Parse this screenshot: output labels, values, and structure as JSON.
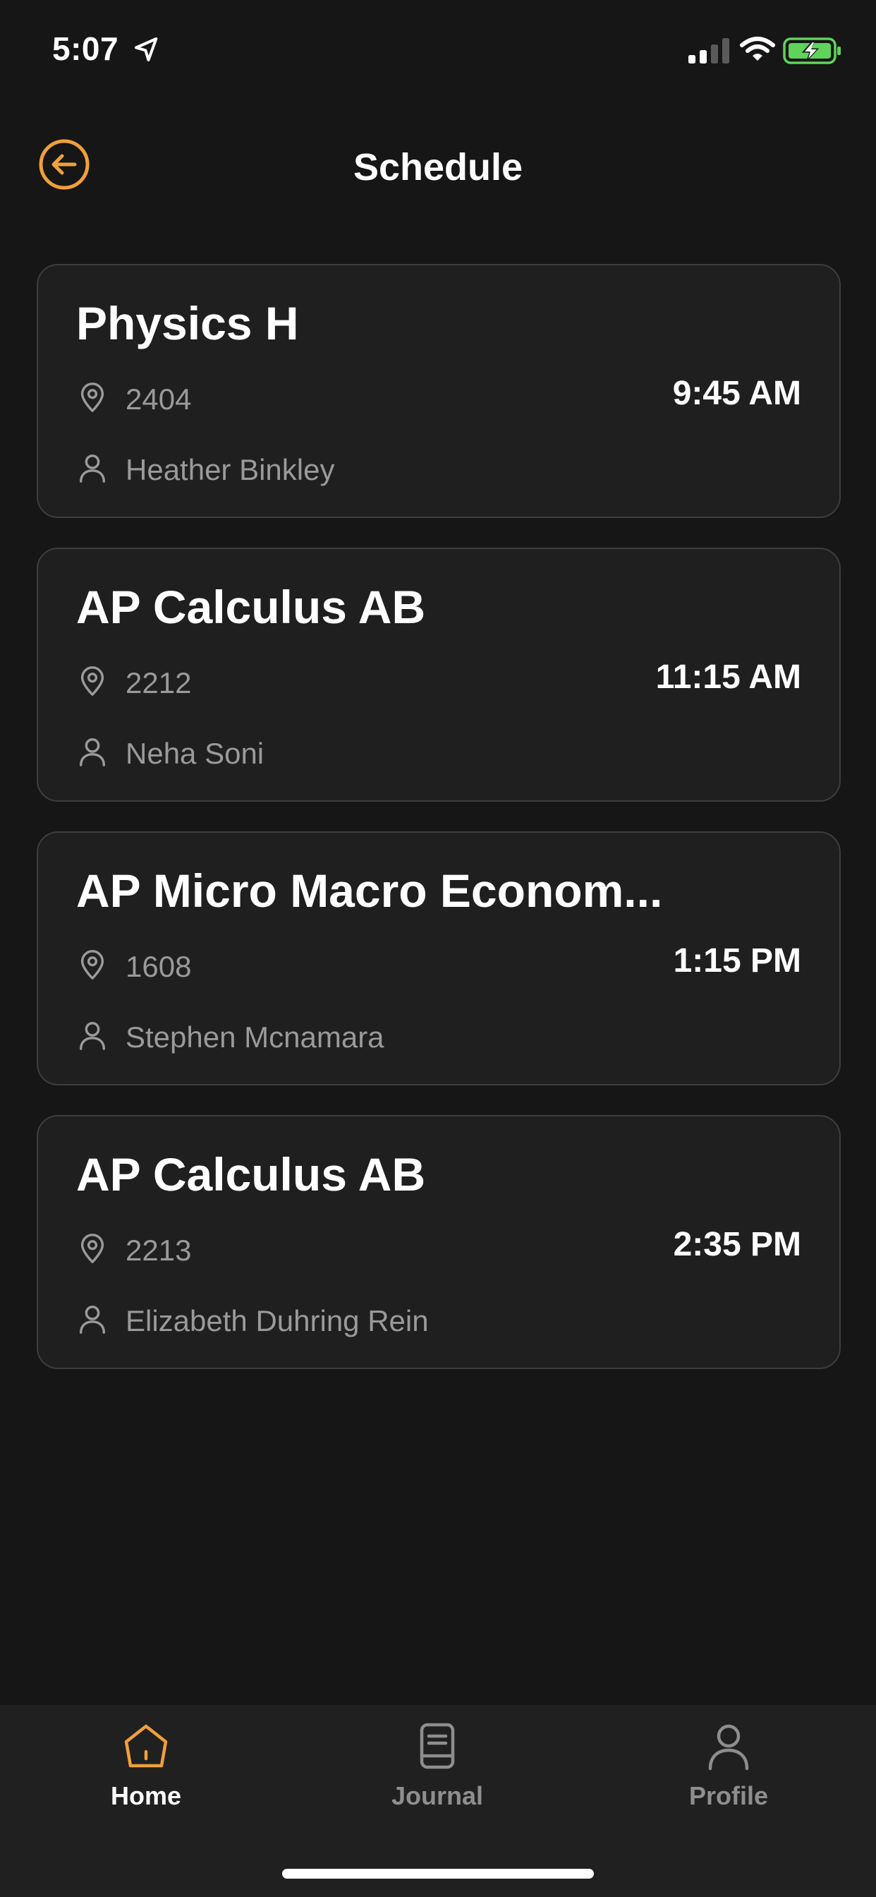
{
  "status_bar": {
    "time": "5:07",
    "icons": [
      "location-arrow-icon",
      "cellular-signal-icon",
      "wifi-icon",
      "battery-charging-icon"
    ]
  },
  "header": {
    "title": "Schedule",
    "back_icon": "back-arrow-icon"
  },
  "colors": {
    "accent": "#F0A03A",
    "background": "#161616",
    "card": "#1F1F1F",
    "card_border": "#3D3D3D",
    "secondary_text": "#9A9A9A",
    "battery_green": "#5FD35A"
  },
  "classes": [
    {
      "name": "Physics H",
      "room": "2404",
      "teacher": "Heather Binkley",
      "time": "9:45 AM"
    },
    {
      "name": "AP Calculus AB",
      "room": "2212",
      "teacher": "Neha Soni",
      "time": "11:15 AM"
    },
    {
      "name": "AP Micro Macro Econom...",
      "room": "1608",
      "teacher": "Stephen Mcnamara",
      "time": "1:15 PM"
    },
    {
      "name": "AP Calculus AB",
      "room": "2213",
      "teacher": "Elizabeth Duhring Rein",
      "time": "2:35 PM"
    }
  ],
  "tab_bar": {
    "tabs": [
      {
        "label": "Home",
        "icon": "home-icon",
        "active": true
      },
      {
        "label": "Journal",
        "icon": "journal-icon",
        "active": false
      },
      {
        "label": "Profile",
        "icon": "profile-icon",
        "active": false
      }
    ]
  }
}
